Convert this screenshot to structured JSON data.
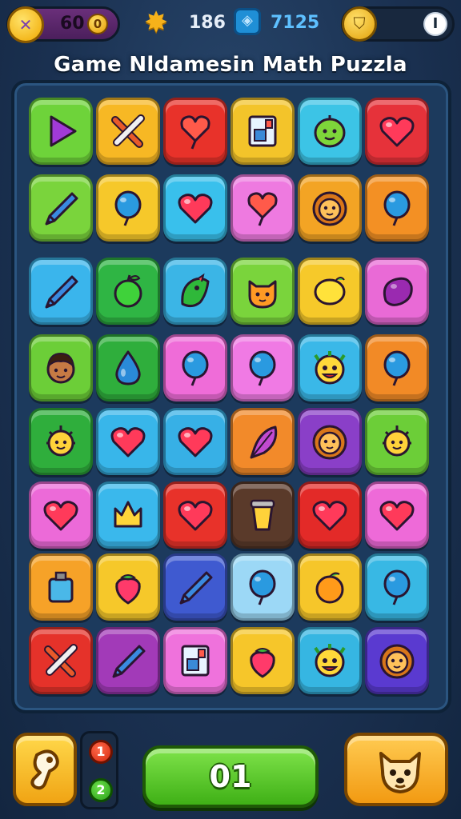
{
  "hud": {
    "coins": "60",
    "coin_badge": "0",
    "stat_star": "186",
    "stat_gem": "7125",
    "info_label": "I"
  },
  "title": "Game Nldamesin Math Puzzla",
  "board": {
    "rows": [
      [
        {
          "color": "#6ed33a",
          "icon": "play-triangle"
        },
        {
          "color": "#f7b824",
          "icon": "pencil-cross"
        },
        {
          "color": "#e8322a",
          "icon": "heart-balloon"
        },
        {
          "color": "#f3c42a",
          "icon": "frame-box"
        },
        {
          "color": "#3cc4e6",
          "icon": "smiley-face"
        },
        {
          "color": "#e6323a",
          "icon": "heart"
        }
      ],
      [
        {
          "color": "#7ad43c",
          "icon": "pencil"
        },
        {
          "color": "#f6c82a",
          "icon": "balloon"
        },
        {
          "color": "#39c0ec",
          "icon": "heart"
        },
        {
          "color": "#ee7ae0",
          "icon": "heart-balloon"
        },
        {
          "color": "#f3a424",
          "icon": "lion-face"
        },
        {
          "color": "#f39024",
          "icon": "balloon"
        }
      ],
      [
        {
          "color": "#3ab5ec",
          "icon": "pencil"
        },
        {
          "color": "#2fb544",
          "icon": "apple"
        },
        {
          "color": "#3bb5e6",
          "icon": "leaf-creature"
        },
        {
          "color": "#7ad43c",
          "icon": "cat-face"
        },
        {
          "color": "#f6c92a",
          "icon": "lemon"
        },
        {
          "color": "#e96ad6",
          "icon": "plum"
        }
      ],
      [
        {
          "color": "#6cce38",
          "icon": "boy-face"
        },
        {
          "color": "#2fae3c",
          "icon": "water-drop"
        },
        {
          "color": "#ef6cd8",
          "icon": "balloon"
        },
        {
          "color": "#f07ae4",
          "icon": "balloon"
        },
        {
          "color": "#3ab8e8",
          "icon": "monster-face"
        },
        {
          "color": "#f28a26",
          "icon": "balloon"
        }
      ],
      [
        {
          "color": "#2fae3c",
          "icon": "sun-face"
        },
        {
          "color": "#38b6ea",
          "icon": "heart"
        },
        {
          "color": "#37b0e6",
          "icon": "heart"
        },
        {
          "color": "#f28a2a",
          "icon": "feather"
        },
        {
          "color": "#8a3fc8",
          "icon": "lion-face"
        },
        {
          "color": "#6cce38",
          "icon": "sun-face"
        }
      ],
      [
        {
          "color": "#ec6ad8",
          "icon": "heart"
        },
        {
          "color": "#3ab8ec",
          "icon": "crown"
        },
        {
          "color": "#e8322a",
          "icon": "heart"
        },
        {
          "color": "#5a3a2a",
          "icon": "cup"
        },
        {
          "color": "#e32a28",
          "icon": "heart"
        },
        {
          "color": "#ee6ad8",
          "icon": "heart"
        }
      ],
      [
        {
          "color": "#f6a228",
          "icon": "bottle"
        },
        {
          "color": "#f6c82a",
          "icon": "strawberry"
        },
        {
          "color": "#3f5ad0",
          "icon": "pencil"
        },
        {
          "color": "#9cd8f6",
          "icon": "balloon"
        },
        {
          "color": "#f6c62a",
          "icon": "orange"
        },
        {
          "color": "#38b8e4",
          "icon": "balloon"
        }
      ],
      [
        {
          "color": "#e5322a",
          "icon": "pencil-cross"
        },
        {
          "color": "#a23ab8",
          "icon": "pencil"
        },
        {
          "color": "#ef72dc",
          "icon": "frame-box"
        },
        {
          "color": "#f6c62a",
          "icon": "strawberry"
        },
        {
          "color": "#36b6e2",
          "icon": "monster-face"
        },
        {
          "color": "#5a3ad0",
          "icon": "lion-face"
        }
      ]
    ]
  },
  "controls": {
    "badge_red": "1",
    "badge_green": "2",
    "main_label": "01"
  }
}
